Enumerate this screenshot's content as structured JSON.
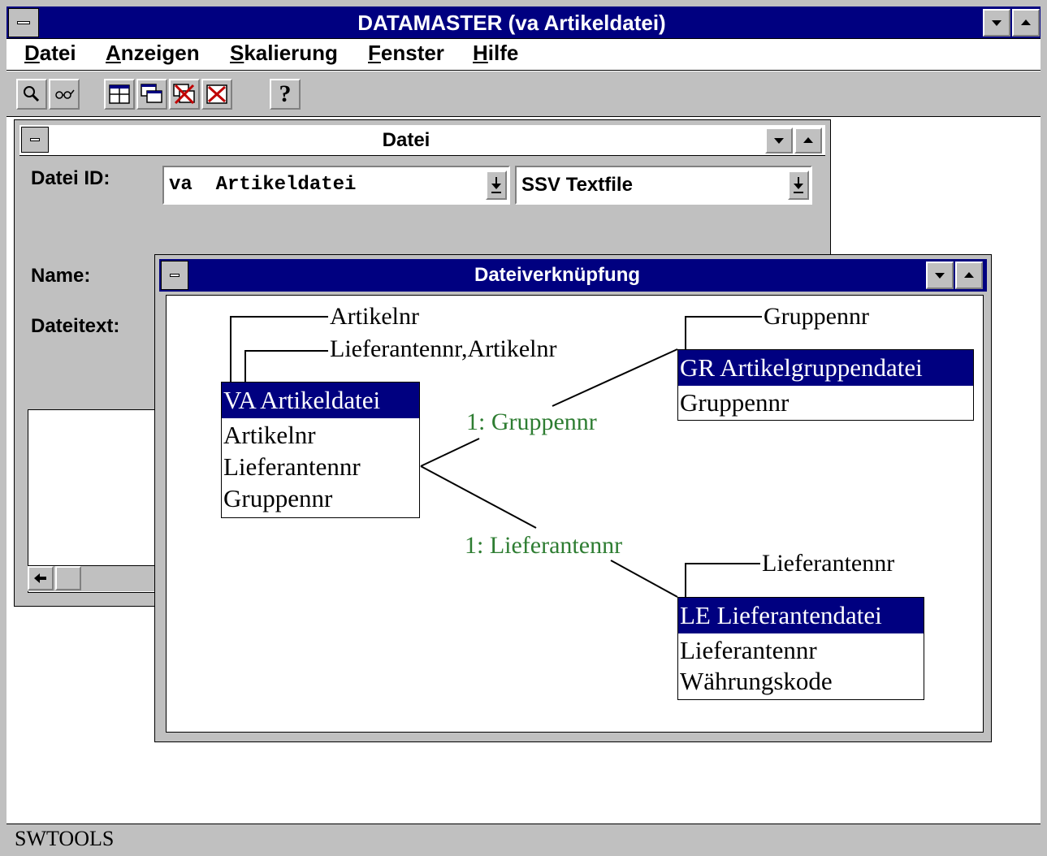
{
  "app": {
    "title": "DATAMASTER (va Artikeldatei)"
  },
  "menu": [
    {
      "label": "Datei",
      "accel": "D",
      "rest": "atei"
    },
    {
      "label": "Anzeigen",
      "accel": "A",
      "rest": "nzeigen"
    },
    {
      "label": "Skalierung",
      "accel": "S",
      "rest": "kalierung"
    },
    {
      "label": "Fenster",
      "accel": "F",
      "rest": "enster"
    },
    {
      "label": "Hilfe",
      "accel": "H",
      "rest": "ilfe"
    }
  ],
  "toolbar": {
    "icons": [
      "search-icon",
      "glasses-icon",
      "tile-icon",
      "cascade-icon",
      "close-windows-icon",
      "close-all-icon",
      "help-icon"
    ],
    "help_glyph": "?"
  },
  "datei_window": {
    "title": "Datei",
    "datei_id_label": "Datei ID:",
    "datei_id_value": "va  Artikeldatei",
    "type_value": "SSV Textfile",
    "name_label": "Name:",
    "dateitext_label": "Dateitext:"
  },
  "link_window": {
    "title": "Dateiverknüpfung",
    "main_table": {
      "header": "VA Artikeldatei",
      "fields": [
        "Artikelnr",
        "Lieferantennr",
        "Gruppennr"
      ],
      "keys": [
        "Artikelnr",
        "Lieferantennr,Artikelnr"
      ]
    },
    "group_table": {
      "header": "GR Artikelgruppendatei",
      "fields": [
        "Gruppennr"
      ],
      "key": "Gruppennr"
    },
    "supplier_table": {
      "header": "LE Lieferantendatei",
      "fields": [
        "Lieferantennr",
        "Währungskode"
      ],
      "key": "Lieferantennr"
    },
    "relations": [
      "1: Gruppennr",
      "1: Lieferantennr"
    ]
  },
  "status": {
    "text": "SWTOOLS"
  },
  "colors": {
    "title_active": "#000080",
    "face": "#c0c0c0",
    "relation_text": "#2e7d32"
  }
}
